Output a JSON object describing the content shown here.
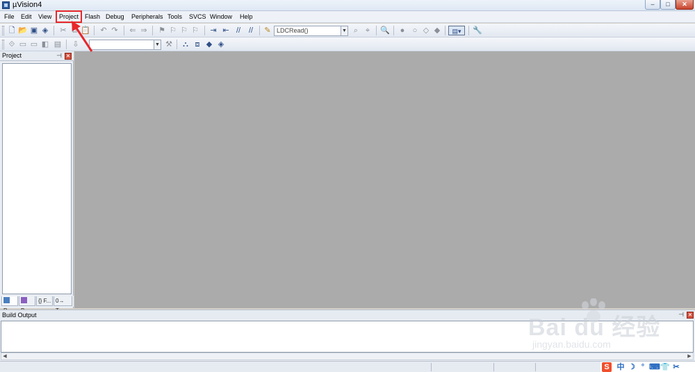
{
  "window": {
    "title": "µVision4",
    "controls": {
      "minimize": "–",
      "maximize": "□",
      "close": "✕"
    }
  },
  "menu": [
    {
      "label": "File"
    },
    {
      "label": "Edit"
    },
    {
      "label": "View"
    },
    {
      "label": "Project"
    },
    {
      "label": "Flash"
    },
    {
      "label": "Debug"
    },
    {
      "label": "Peripherals"
    },
    {
      "label": "Tools"
    },
    {
      "label": "SVCS"
    },
    {
      "label": "Window"
    },
    {
      "label": "Help"
    }
  ],
  "toolbar": {
    "target_combo_value": "LDCRead()",
    "build_combo_value": ""
  },
  "project_panel": {
    "title": "Project",
    "tabs": [
      {
        "label": "P..."
      },
      {
        "label": "B..."
      },
      {
        "label": "{} F..."
      },
      {
        "label": "0→ T..."
      }
    ]
  },
  "build_output": {
    "title": "Build Output",
    "text": ""
  },
  "watermark": {
    "logo": "Bai du 经验",
    "url": "jingyan.baidu.com"
  },
  "tray": {
    "ime": "S",
    "lang": "中"
  },
  "colors": {
    "highlight_box": "#e8262b",
    "workspace": "#ababab"
  }
}
